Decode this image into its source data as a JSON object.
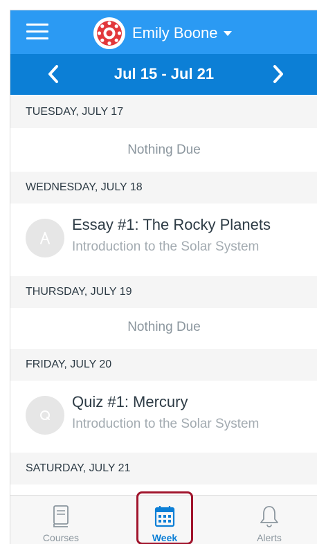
{
  "header": {
    "user_name": "Emily Boone",
    "week_range": "Jul 15 - Jul 21"
  },
  "days": [
    {
      "label": "TUESDAY, JULY 17",
      "empty_text": "Nothing Due"
    },
    {
      "label": "WEDNESDAY, JULY 18",
      "item": {
        "title": "Essay #1: The Rocky Planets",
        "course": "Introduction to the Solar System",
        "icon": "assignment-icon"
      }
    },
    {
      "label": "THURSDAY, JULY 19",
      "empty_text": "Nothing Due"
    },
    {
      "label": "FRIDAY, JULY 20",
      "item": {
        "title": "Quiz #1: Mercury",
        "course": "Introduction to the Solar System",
        "icon": "quiz-icon"
      }
    },
    {
      "label": "SATURDAY, JULY 21"
    }
  ],
  "tabs": [
    {
      "label": "Courses",
      "icon": "book-icon",
      "selected": false
    },
    {
      "label": "Week",
      "icon": "calendar-icon",
      "selected": true
    },
    {
      "label": "Alerts",
      "icon": "bell-icon",
      "selected": false
    }
  ],
  "colors": {
    "top_bar": "#2b9af3",
    "week_bar": "#0c7fd6",
    "active_tab": "#0c7fd6",
    "highlight_box": "#a0142c"
  }
}
